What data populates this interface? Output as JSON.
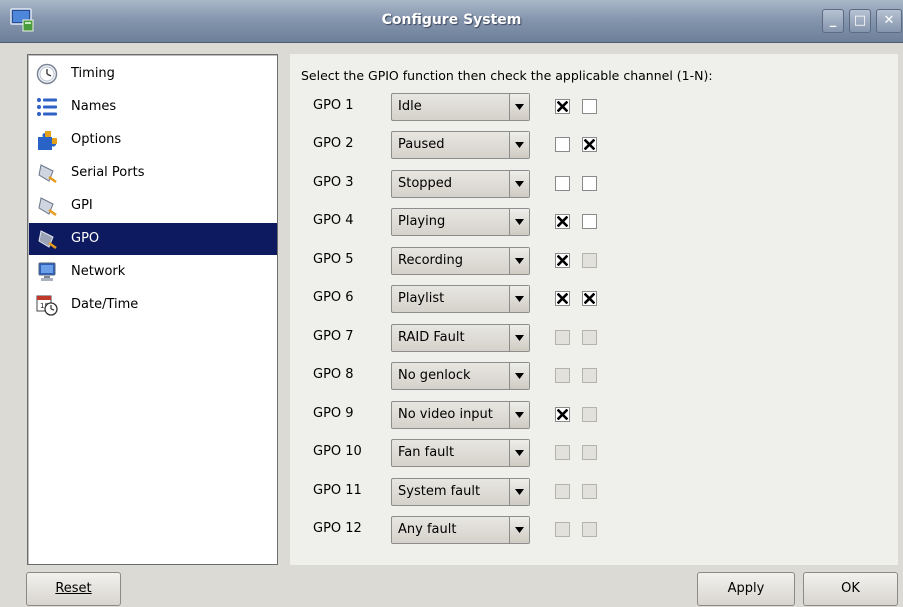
{
  "window": {
    "title": "Configure System",
    "controls": [
      "minimize",
      "maximize",
      "close"
    ]
  },
  "sidebar": {
    "items": [
      {
        "label": "Timing",
        "icon": "clock-icon",
        "selected": false
      },
      {
        "label": "Names",
        "icon": "list-icon",
        "selected": false
      },
      {
        "label": "Options",
        "icon": "puzzle-icon",
        "selected": false
      },
      {
        "label": "Serial Ports",
        "icon": "connector-icon",
        "selected": false
      },
      {
        "label": "GPI",
        "icon": "connector-icon",
        "selected": false
      },
      {
        "label": "GPO",
        "icon": "connector-icon",
        "selected": true
      },
      {
        "label": "Network",
        "icon": "monitor-icon",
        "selected": false
      },
      {
        "label": "Date/Time",
        "icon": "calendar-clock-icon",
        "selected": false
      }
    ]
  },
  "panel": {
    "instruction": "Select the GPIO function then check the applicable channel (1-N):",
    "gpo_rows": [
      {
        "label": "GPO 1",
        "function": "Idle",
        "ch1": "checked",
        "ch2": "unchecked"
      },
      {
        "label": "GPO 2",
        "function": "Paused",
        "ch1": "unchecked",
        "ch2": "checked"
      },
      {
        "label": "GPO 3",
        "function": "Stopped",
        "ch1": "unchecked",
        "ch2": "unchecked"
      },
      {
        "label": "GPO 4",
        "function": "Playing",
        "ch1": "checked",
        "ch2": "unchecked"
      },
      {
        "label": "GPO 5",
        "function": "Recording",
        "ch1": "checked",
        "ch2": "disabled"
      },
      {
        "label": "GPO 6",
        "function": "Playlist",
        "ch1": "checked",
        "ch2": "checked"
      },
      {
        "label": "GPO 7",
        "function": "RAID Fault",
        "ch1": "disabled",
        "ch2": "disabled"
      },
      {
        "label": "GPO 8",
        "function": "No genlock",
        "ch1": "disabled",
        "ch2": "disabled"
      },
      {
        "label": "GPO 9",
        "function": "No video input",
        "ch1": "checked",
        "ch2": "disabled"
      },
      {
        "label": "GPO 10",
        "function": "Fan fault",
        "ch1": "disabled",
        "ch2": "disabled"
      },
      {
        "label": "GPO 11",
        "function": "System fault",
        "ch1": "disabled",
        "ch2": "disabled"
      },
      {
        "label": "GPO 12",
        "function": "Any fault",
        "ch1": "disabled",
        "ch2": "disabled"
      }
    ]
  },
  "buttons": {
    "reset_label": "Reset",
    "apply_label": "Apply",
    "ok_label": "OK"
  },
  "colors": {
    "selection": "#0e1a60",
    "titlebar": "#8596ae"
  }
}
